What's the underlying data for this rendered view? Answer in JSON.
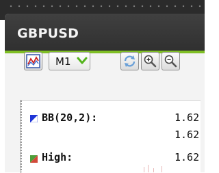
{
  "window": {
    "title": "GBPUSD"
  },
  "toolbar": {
    "timeframe": {
      "value": "M1"
    },
    "buttons": [
      {
        "name": "chart-type-button",
        "icon": "line-chart-icon"
      },
      {
        "name": "refresh-button",
        "icon": "refresh-icon"
      },
      {
        "name": "zoom-in-button",
        "icon": "zoom-in-icon"
      },
      {
        "name": "zoom-out-button",
        "icon": "zoom-out-icon"
      }
    ]
  },
  "legend": [
    {
      "label": "BB(20,2):",
      "values": [
        "1.62",
        "1.62"
      ],
      "color": "#2233cc",
      "icon": "blue-triangle-swatch"
    },
    {
      "label": "High:",
      "values": [
        "1.62"
      ],
      "color": "#cc6655",
      "icon": "green-red-swatch"
    }
  ],
  "colors": {
    "accent": "#7fbf25",
    "titlebar": "#353535"
  }
}
